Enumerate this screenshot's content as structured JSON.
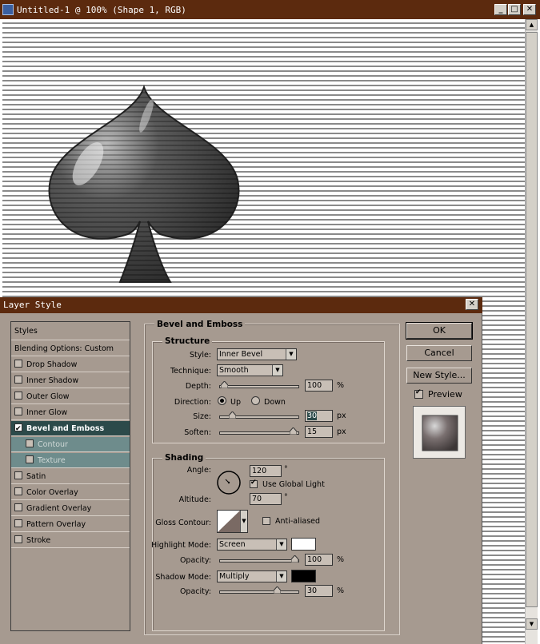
{
  "document": {
    "title": "Untitled-1 @ 100% (Shape 1, RGB)",
    "window_buttons": [
      "_",
      "□",
      "✕"
    ]
  },
  "dialog": {
    "title": "Layer Style",
    "close": "✕",
    "styles_list": [
      {
        "label": "Styles",
        "checkbox": false,
        "checked": false,
        "selected": false,
        "sub": false
      },
      {
        "label": "Blending Options: Custom",
        "checkbox": false,
        "checked": false,
        "selected": false,
        "sub": false
      },
      {
        "label": "Drop Shadow",
        "checkbox": true,
        "checked": false,
        "selected": false,
        "sub": false
      },
      {
        "label": "Inner Shadow",
        "checkbox": true,
        "checked": false,
        "selected": false,
        "sub": false
      },
      {
        "label": "Outer Glow",
        "checkbox": true,
        "checked": false,
        "selected": false,
        "sub": false
      },
      {
        "label": "Inner Glow",
        "checkbox": true,
        "checked": false,
        "selected": false,
        "sub": false
      },
      {
        "label": "Bevel and Emboss",
        "checkbox": true,
        "checked": true,
        "selected": true,
        "sub": false
      },
      {
        "label": "Contour",
        "checkbox": true,
        "checked": false,
        "selected": false,
        "sub": true
      },
      {
        "label": "Texture",
        "checkbox": true,
        "checked": false,
        "selected": false,
        "sub": true
      },
      {
        "label": "Satin",
        "checkbox": true,
        "checked": false,
        "selected": false,
        "sub": false
      },
      {
        "label": "Color Overlay",
        "checkbox": true,
        "checked": false,
        "selected": false,
        "sub": false
      },
      {
        "label": "Gradient Overlay",
        "checkbox": true,
        "checked": false,
        "selected": false,
        "sub": false
      },
      {
        "label": "Pattern Overlay",
        "checkbox": true,
        "checked": false,
        "selected": false,
        "sub": false
      },
      {
        "label": "Stroke",
        "checkbox": true,
        "checked": false,
        "selected": false,
        "sub": false
      }
    ],
    "bevel": {
      "title": "Bevel and Emboss",
      "structure": {
        "title": "Structure",
        "style_label": "Style:",
        "style_value": "Inner Bevel",
        "technique_label": "Technique:",
        "technique_value": "Smooth",
        "depth_label": "Depth:",
        "depth_value": "100",
        "depth_unit": "%",
        "depth_level": 0.01,
        "direction_label": "Direction:",
        "direction_up": "Up",
        "direction_down": "Down",
        "size_label": "Size:",
        "size_value": "30",
        "size_unit": "px",
        "size_level": 0.12,
        "soften_label": "Soften:",
        "soften_value": "15",
        "soften_unit": "px",
        "soften_level": 0.98
      },
      "shading": {
        "title": "Shading",
        "angle_label": "Angle:",
        "angle_value": "120",
        "angle_unit": "°",
        "global_light_label": "Use Global Light",
        "global_light_checked": true,
        "altitude_label": "Altitude:",
        "altitude_value": "70",
        "altitude_unit": "°",
        "gloss_contour_label": "Gloss Contour:",
        "anti_aliased_label": "Anti-aliased",
        "anti_aliased_checked": false,
        "highlight_mode_label": "Highlight Mode:",
        "highlight_mode_value": "Screen",
        "highlight_color": "#ffffff",
        "highlight_opacity_label": "Opacity:",
        "highlight_opacity_value": "100",
        "highlight_opacity_unit": "%",
        "highlight_opacity_level": 1.0,
        "shadow_mode_label": "Shadow Mode:",
        "shadow_mode_value": "Multiply",
        "shadow_color": "#000000",
        "shadow_opacity_label": "Opacity:",
        "shadow_opacity_value": "30",
        "shadow_opacity_unit": "%",
        "shadow_opacity_level": 0.75
      }
    },
    "buttons": {
      "ok": "OK",
      "cancel": "Cancel",
      "new_style": "New Style...",
      "preview_label": "Preview",
      "preview_checked": true
    }
  },
  "colors": {
    "title_bar": "#5c2a0e",
    "dialog_bg": "#a69a90",
    "selected_row": "#2c4a4a"
  }
}
